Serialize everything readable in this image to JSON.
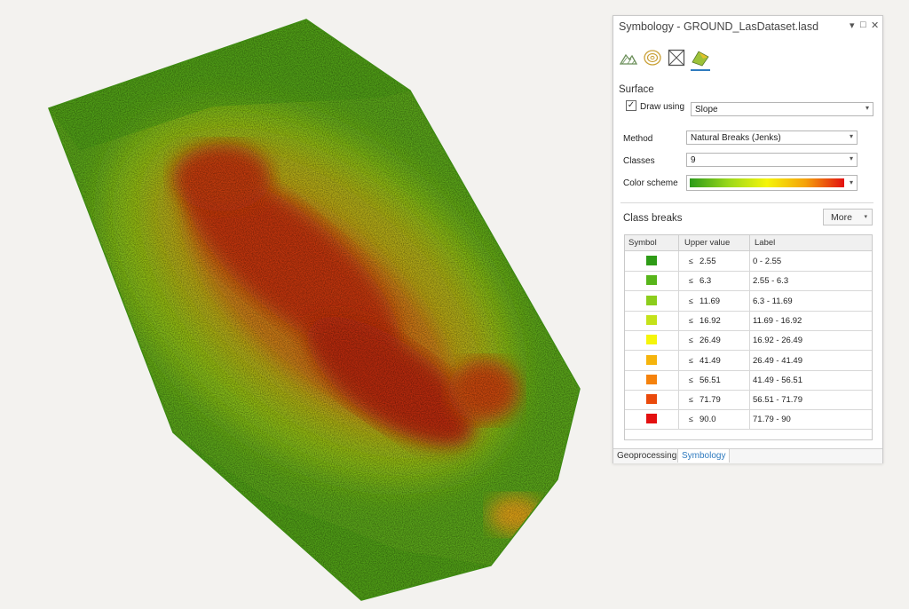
{
  "panel": {
    "title": "Symbology - GROUND_LasDataset.lasd",
    "controls": {
      "menu": "▾",
      "maximize": "□",
      "close": "✕"
    },
    "tab_icons": [
      "points-icon",
      "contours-icon",
      "edges-icon",
      "surface-icon"
    ],
    "surface_heading": "Surface",
    "draw_using": {
      "checked": true,
      "label": "Draw using",
      "value": "Slope"
    },
    "method": {
      "label": "Method",
      "value": "Natural Breaks (Jenks)"
    },
    "classes": {
      "label": "Classes",
      "value": "9"
    },
    "color_scheme": {
      "label": "Color scheme",
      "ramp": [
        "#2c9a1a",
        "#9ad81a",
        "#f5f50a",
        "#f5a10a",
        "#e31010"
      ]
    },
    "class_breaks": {
      "heading": "Class breaks",
      "more_label": "More",
      "columns": [
        "Symbol",
        "Upper value",
        "Label"
      ],
      "le_symbol": "≤",
      "rows": [
        {
          "color": "#2e9b16",
          "upper": "2.55",
          "label": "0 - 2.55"
        },
        {
          "color": "#58b51a",
          "upper": "6.3",
          "label": "2.55 - 6.3"
        },
        {
          "color": "#8ccd1c",
          "upper": "11.69",
          "label": "6.3 - 11.69"
        },
        {
          "color": "#c4e21a",
          "upper": "16.92",
          "label": "11.69 - 16.92"
        },
        {
          "color": "#f5f50a",
          "upper": "26.49",
          "label": "16.92 - 26.49"
        },
        {
          "color": "#f5b40c",
          "upper": "41.49",
          "label": "26.49 - 41.49"
        },
        {
          "color": "#f5820c",
          "upper": "56.51",
          "label": "41.49 - 56.51"
        },
        {
          "color": "#ea4a0c",
          "upper": "71.79",
          "label": "56.51 - 71.79"
        },
        {
          "color": "#e31010",
          "upper": "90.0",
          "label": "71.79 - 90"
        }
      ]
    },
    "bottom_tabs": [
      {
        "label": "Geoprocessing",
        "active": false
      },
      {
        "label": "Symbology",
        "active": true
      }
    ]
  }
}
